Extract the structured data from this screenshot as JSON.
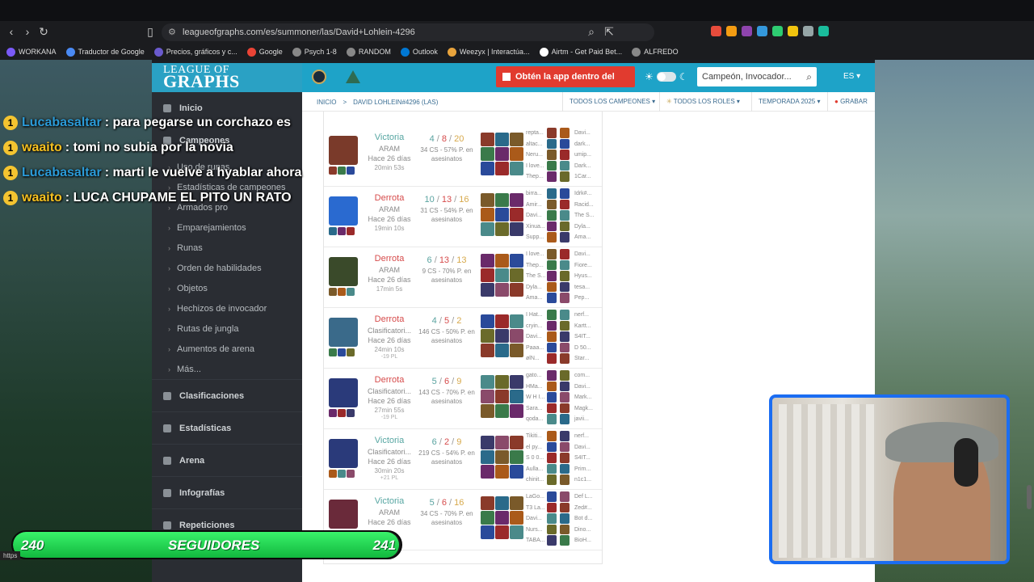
{
  "browser": {
    "url": "leagueofgraphs.com/es/summoner/las/David+Lohlein-4296",
    "status_url": "https"
  },
  "bookmarks": [
    {
      "label": "WORKANA",
      "color": "#7a5af8"
    },
    {
      "label": "Traductor de Google",
      "color": "#4a8af4"
    },
    {
      "label": "Precios, gráficos y c...",
      "color": "#6a5acd"
    },
    {
      "label": "Google",
      "color": "#ea4335"
    },
    {
      "label": "Psych 1-8",
      "color": "#888"
    },
    {
      "label": "RANDOM",
      "color": "#888"
    },
    {
      "label": "Outlook",
      "color": "#0078d4"
    },
    {
      "label": "Weezyx | Interactúa...",
      "color": "#e8a33c"
    },
    {
      "label": "Airtm - Get Paid Bet...",
      "color": "#fff"
    },
    {
      "label": "ALFREDO",
      "color": "#888"
    }
  ],
  "site": {
    "logo_top": "LEAGUE OF",
    "logo_bottom": "GRAPHS",
    "app_button": "Obtén la app dentro del juego",
    "search_placeholder": "Campeón, Invocador...",
    "lang": "ES"
  },
  "breadcrumb": {
    "home": "INICIO",
    "sep": ">",
    "summoner": "DAVID LOHLEIN#4296 (LAS)"
  },
  "filters": {
    "champions": "TODOS LOS CAMPEONES",
    "roles": "TODOS LOS ROLES",
    "season": "TEMPORADA 2025",
    "record": "GRABAR"
  },
  "sidebar": {
    "main": [
      {
        "label": "Inicio"
      },
      {
        "label": "Campeones"
      }
    ],
    "sub": [
      {
        "label": "Uso de runas"
      },
      {
        "label": "Estadísticas de campeones"
      },
      {
        "label": "Armados pro"
      },
      {
        "label": "Emparejamientos"
      },
      {
        "label": "Runas"
      },
      {
        "label": "Orden de habilidades"
      },
      {
        "label": "Objetos"
      },
      {
        "label": "Hechizos de invocador"
      },
      {
        "label": "Rutas de jungla"
      },
      {
        "label": "Aumentos de arena"
      },
      {
        "label": "Más..."
      }
    ],
    "bottom": [
      {
        "label": "Clasificaciones"
      },
      {
        "label": "Estadísticas"
      },
      {
        "label": "Arena"
      },
      {
        "label": "Infografías"
      },
      {
        "label": "Repeticiones"
      }
    ]
  },
  "games": [
    {
      "result": "Victoria",
      "win": true,
      "mode": "ARAM",
      "ago": "Hace 26 días",
      "duration": "20min 53s",
      "lp": "",
      "k": "4",
      "d": "8",
      "a": "20",
      "cs": "34 CS - 57% P. en asesinatos",
      "team_a": [
        "repta...",
        "altac...",
        "Neru...",
        "I love...",
        "Thep..."
      ],
      "team_b": [
        "Davi...",
        "dark...",
        "umip...",
        "Dark...",
        "1Car..."
      ],
      "champ_color": "#7a3a2a"
    },
    {
      "result": "Derrota",
      "win": false,
      "mode": "ARAM",
      "ago": "Hace 26 días",
      "duration": "19min 10s",
      "lp": "",
      "k": "10",
      "d": "13",
      "a": "16",
      "cs": "31 CS - 54% P. en asesinatos",
      "team_a": [
        "birra...",
        "Amir...",
        "Davi...",
        "Xinua...",
        "Supp..."
      ],
      "team_b": [
        "Idrk#...",
        "Racid...",
        "The S...",
        "Dyla...",
        "Ama..."
      ],
      "champ_color": "#2a6ad0"
    },
    {
      "result": "Derrota",
      "win": false,
      "mode": "ARAM",
      "ago": "Hace 26 días",
      "duration": "17min 5s",
      "lp": "",
      "k": "6",
      "d": "13",
      "a": "13",
      "cs": "9 CS - 70% P. en asesinatos",
      "team_a": [
        "I love...",
        "Thep...",
        "The S...",
        "Dyla...",
        "Ama..."
      ],
      "team_b": [
        "Davi...",
        "Fiore...",
        "Hyus...",
        "tesa...",
        "Pep..."
      ],
      "champ_color": "#3a4a2a"
    },
    {
      "result": "Derrota",
      "win": false,
      "mode": "Clasificatori...",
      "ago": "Hace 26 días",
      "duration": "24min 10s",
      "lp": "-19 PL",
      "k": "4",
      "d": "5",
      "a": "2",
      "cs": "146 CS - 50% P. en asesinatos",
      "team_a": [
        "I Hat...",
        "cryin...",
        "Davi...",
        "Paaa...",
        "ølN..."
      ],
      "team_b": [
        "nerf...",
        "Kartt...",
        "S4IT...",
        "D 50...",
        "Star..."
      ],
      "champ_color": "#3a6a8a"
    },
    {
      "result": "Derrota",
      "win": false,
      "mode": "Clasificatori...",
      "ago": "Hace 26 días",
      "duration": "27min 55s",
      "lp": "-19 PL",
      "k": "5",
      "d": "6",
      "a": "9",
      "cs": "143 CS - 70% P. en asesinatos",
      "team_a": [
        "gato...",
        "HMa...",
        "W H I...",
        "Sara...",
        "qoda..."
      ],
      "team_b": [
        "com...",
        "Davi...",
        "Mark...",
        "Magk...",
        "javii..."
      ],
      "champ_color": "#2a3a7a"
    },
    {
      "result": "Victoria",
      "win": true,
      "mode": "Clasificatori...",
      "ago": "Hace 26 días",
      "duration": "30min 20s",
      "lp": "+21 PL",
      "k": "6",
      "d": "2",
      "a": "9",
      "cs": "219 CS - 54% P. en asesinatos",
      "team_a": [
        "Tikiti...",
        "el py...",
        "S 0 0...",
        "Aulla...",
        "chinit..."
      ],
      "team_b": [
        "nerf...",
        "Davi...",
        "S4IT...",
        "Prim...",
        "n1c1..."
      ],
      "champ_color": "#2a3a7a"
    },
    {
      "result": "Victoria",
      "win": true,
      "mode": "ARAM",
      "ago": "Hace 26 días",
      "duration": "",
      "lp": "",
      "k": "5",
      "d": "6",
      "a": "16",
      "cs": "34 CS - 70% P. en asesinatos",
      "team_a": [
        "LaGo...",
        "T3 La...",
        "Davi...",
        "Nurs...",
        "TABA..."
      ],
      "team_b": [
        "Def L...",
        "Zed#...",
        "Bot d...",
        "Dino...",
        "BioH..."
      ],
      "champ_color": "#6a2a3a"
    }
  ],
  "chat": [
    {
      "user": "Lucabasaltar",
      "text": ": para pegarse un corchazo es",
      "user_color": "#2b9bd8"
    },
    {
      "user": "waaito",
      "text": ": tomi no subia por la novia",
      "user_color": "#f5c020"
    },
    {
      "user": "Lucabasaltar",
      "text": ": marti le vuelve a hyablar ahora",
      "user_color": "#2b9bd8"
    },
    {
      "user": "waaito",
      "text": ": LUCA CHUPAME EL PITO UN RATO",
      "user_color": "#f5c020"
    }
  ],
  "followers": {
    "current": "240",
    "label": "SEGUIDORES",
    "goal": "241",
    "progress": 0.995
  }
}
